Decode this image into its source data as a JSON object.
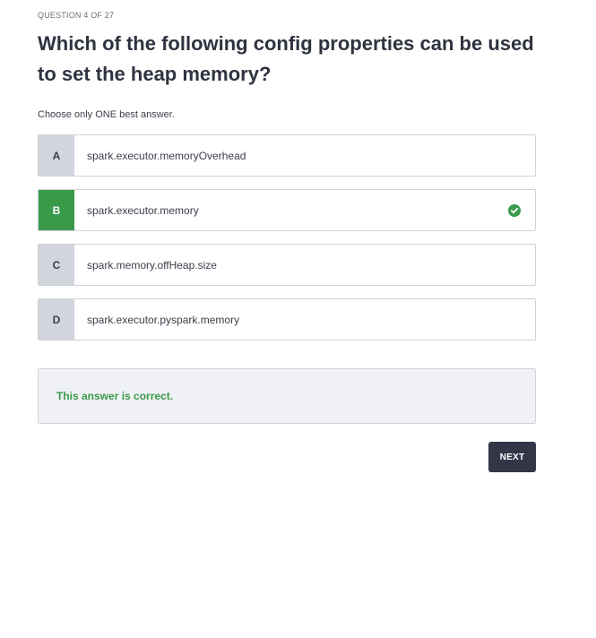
{
  "quiz": {
    "counter": "QUESTION 4 OF 27",
    "question": "Which of the following config properties can be used to set the heap memory?",
    "instruction": "Choose only ONE best answer.",
    "options": [
      {
        "letter": "A",
        "text": "spark.executor.memoryOverhead",
        "selected": false
      },
      {
        "letter": "B",
        "text": "spark.executor.memory",
        "selected": true,
        "status_icon": "check-circle-icon"
      },
      {
        "letter": "C",
        "text": "spark.memory.offHeap.size",
        "selected": false
      },
      {
        "letter": "D",
        "text": "spark.executor.pyspark.memory",
        "selected": false
      }
    ],
    "feedback": "This answer is correct.",
    "next_label": "NEXT"
  },
  "colors": {
    "correct": "#3a9a4a",
    "letter_bg": "#d2d5dc",
    "button_bg": "#343648",
    "feedback_bg": "#f0f1f4"
  }
}
